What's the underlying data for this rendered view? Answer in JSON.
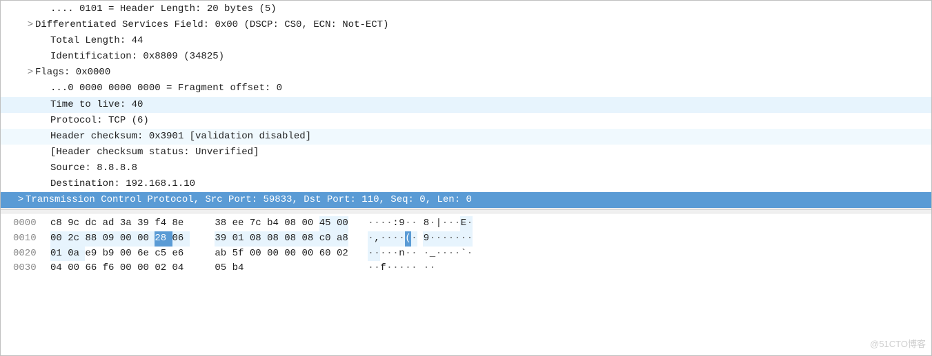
{
  "details": [
    {
      "ind": 2,
      "tw": " ",
      "text": ".... 0101 = Header Length: 20 bytes (5)",
      "hl": "",
      "name": "ip-hdrlen",
      "inter": true
    },
    {
      "ind": 1,
      "tw": ">",
      "text": "Differentiated Services Field: 0x00 (DSCP: CS0, ECN: Not-ECT)",
      "hl": "",
      "name": "ip-dsfield",
      "inter": true
    },
    {
      "ind": 2,
      "tw": " ",
      "text": "Total Length: 44",
      "hl": "",
      "name": "ip-len",
      "inter": true
    },
    {
      "ind": 2,
      "tw": " ",
      "text": "Identification: 0x8809 (34825)",
      "hl": "",
      "name": "ip-id",
      "inter": true
    },
    {
      "ind": 1,
      "tw": ">",
      "text": "Flags: 0x0000",
      "hl": "",
      "name": "ip-flags",
      "inter": true
    },
    {
      "ind": 2,
      "tw": " ",
      "text": "...0 0000 0000 0000 = Fragment offset: 0",
      "hl": "",
      "name": "ip-fragoffset",
      "inter": true
    },
    {
      "ind": 2,
      "tw": " ",
      "text": "Time to live: 40",
      "hl": "hl-light",
      "name": "ip-ttl",
      "inter": true
    },
    {
      "ind": 2,
      "tw": " ",
      "text": "Protocol: TCP (6)",
      "hl": "",
      "name": "ip-proto",
      "inter": true
    },
    {
      "ind": 2,
      "tw": " ",
      "text": "Header checksum: 0x3901 [validation disabled]",
      "hl": "hl-lighter",
      "name": "ip-checksum",
      "inter": true
    },
    {
      "ind": 2,
      "tw": " ",
      "text": "[Header checksum status: Unverified]",
      "hl": "",
      "name": "ip-checksum-status",
      "inter": true
    },
    {
      "ind": 2,
      "tw": " ",
      "text": "Source: 8.8.8.8",
      "hl": "",
      "name": "ip-src",
      "inter": true
    },
    {
      "ind": 2,
      "tw": " ",
      "text": "Destination: 192.168.1.10",
      "hl": "",
      "name": "ip-dst",
      "inter": true
    },
    {
      "ind": 0,
      "tw": ">",
      "text": "Transmission Control Protocol, Src Port: 59833, Dst Port: 110, Seq: 0, Len: 0",
      "hl": "hl-sel",
      "name": "tcp-root",
      "inter": true
    }
  ],
  "hex": {
    "rows": [
      {
        "off": "0000",
        "b": [
          "c8",
          "9c",
          "dc",
          "ad",
          "3a",
          "39",
          "f4",
          "8e",
          "38",
          "ee",
          "7c",
          "b4",
          "08",
          "00",
          "45",
          "00"
        ],
        "a": [
          "·",
          "·",
          "·",
          "·",
          ":",
          "9",
          "·",
          "·",
          "8",
          "·",
          "|",
          "·",
          "·",
          "·",
          "E",
          "·"
        ]
      },
      {
        "off": "0010",
        "b": [
          "00",
          "2c",
          "88",
          "09",
          "00",
          "00",
          "28",
          "06",
          "39",
          "01",
          "08",
          "08",
          "08",
          "08",
          "c0",
          "a8"
        ],
        "a": [
          "·",
          ",",
          "·",
          "·",
          "·",
          "·",
          "(",
          "·",
          "9",
          "·",
          "·",
          "·",
          "·",
          "·",
          "·",
          "·"
        ]
      },
      {
        "off": "0020",
        "b": [
          "01",
          "0a",
          "e9",
          "b9",
          "00",
          "6e",
          "c5",
          "e6",
          "ab",
          "5f",
          "00",
          "00",
          "00",
          "00",
          "60",
          "02"
        ],
        "a": [
          "·",
          "·",
          "·",
          "·",
          "·",
          "n",
          "·",
          "·",
          "·",
          "_",
          "·",
          "·",
          "·",
          "·",
          "`",
          "·"
        ]
      },
      {
        "off": "0030",
        "b": [
          "04",
          "00",
          "66",
          "f6",
          "00",
          "00",
          "02",
          "04",
          "05",
          "b4"
        ],
        "a": [
          "·",
          "·",
          "f",
          "·",
          "·",
          "·",
          "·",
          "·",
          "·",
          "·"
        ]
      }
    ],
    "highlights": {
      "0000": [
        false,
        false,
        false,
        false,
        false,
        false,
        false,
        false,
        false,
        false,
        false,
        false,
        false,
        false,
        true,
        true
      ],
      "0010": [
        true,
        true,
        true,
        true,
        true,
        true,
        "sel",
        true,
        true,
        true,
        true,
        true,
        true,
        true,
        true,
        true
      ],
      "0020": [
        true,
        true,
        false,
        false,
        false,
        false,
        false,
        false,
        false,
        false,
        false,
        false,
        false,
        false,
        false,
        false
      ],
      "0030": [
        false,
        false,
        false,
        false,
        false,
        false,
        false,
        false,
        false,
        false
      ]
    }
  },
  "watermark": "@51CTO博客"
}
